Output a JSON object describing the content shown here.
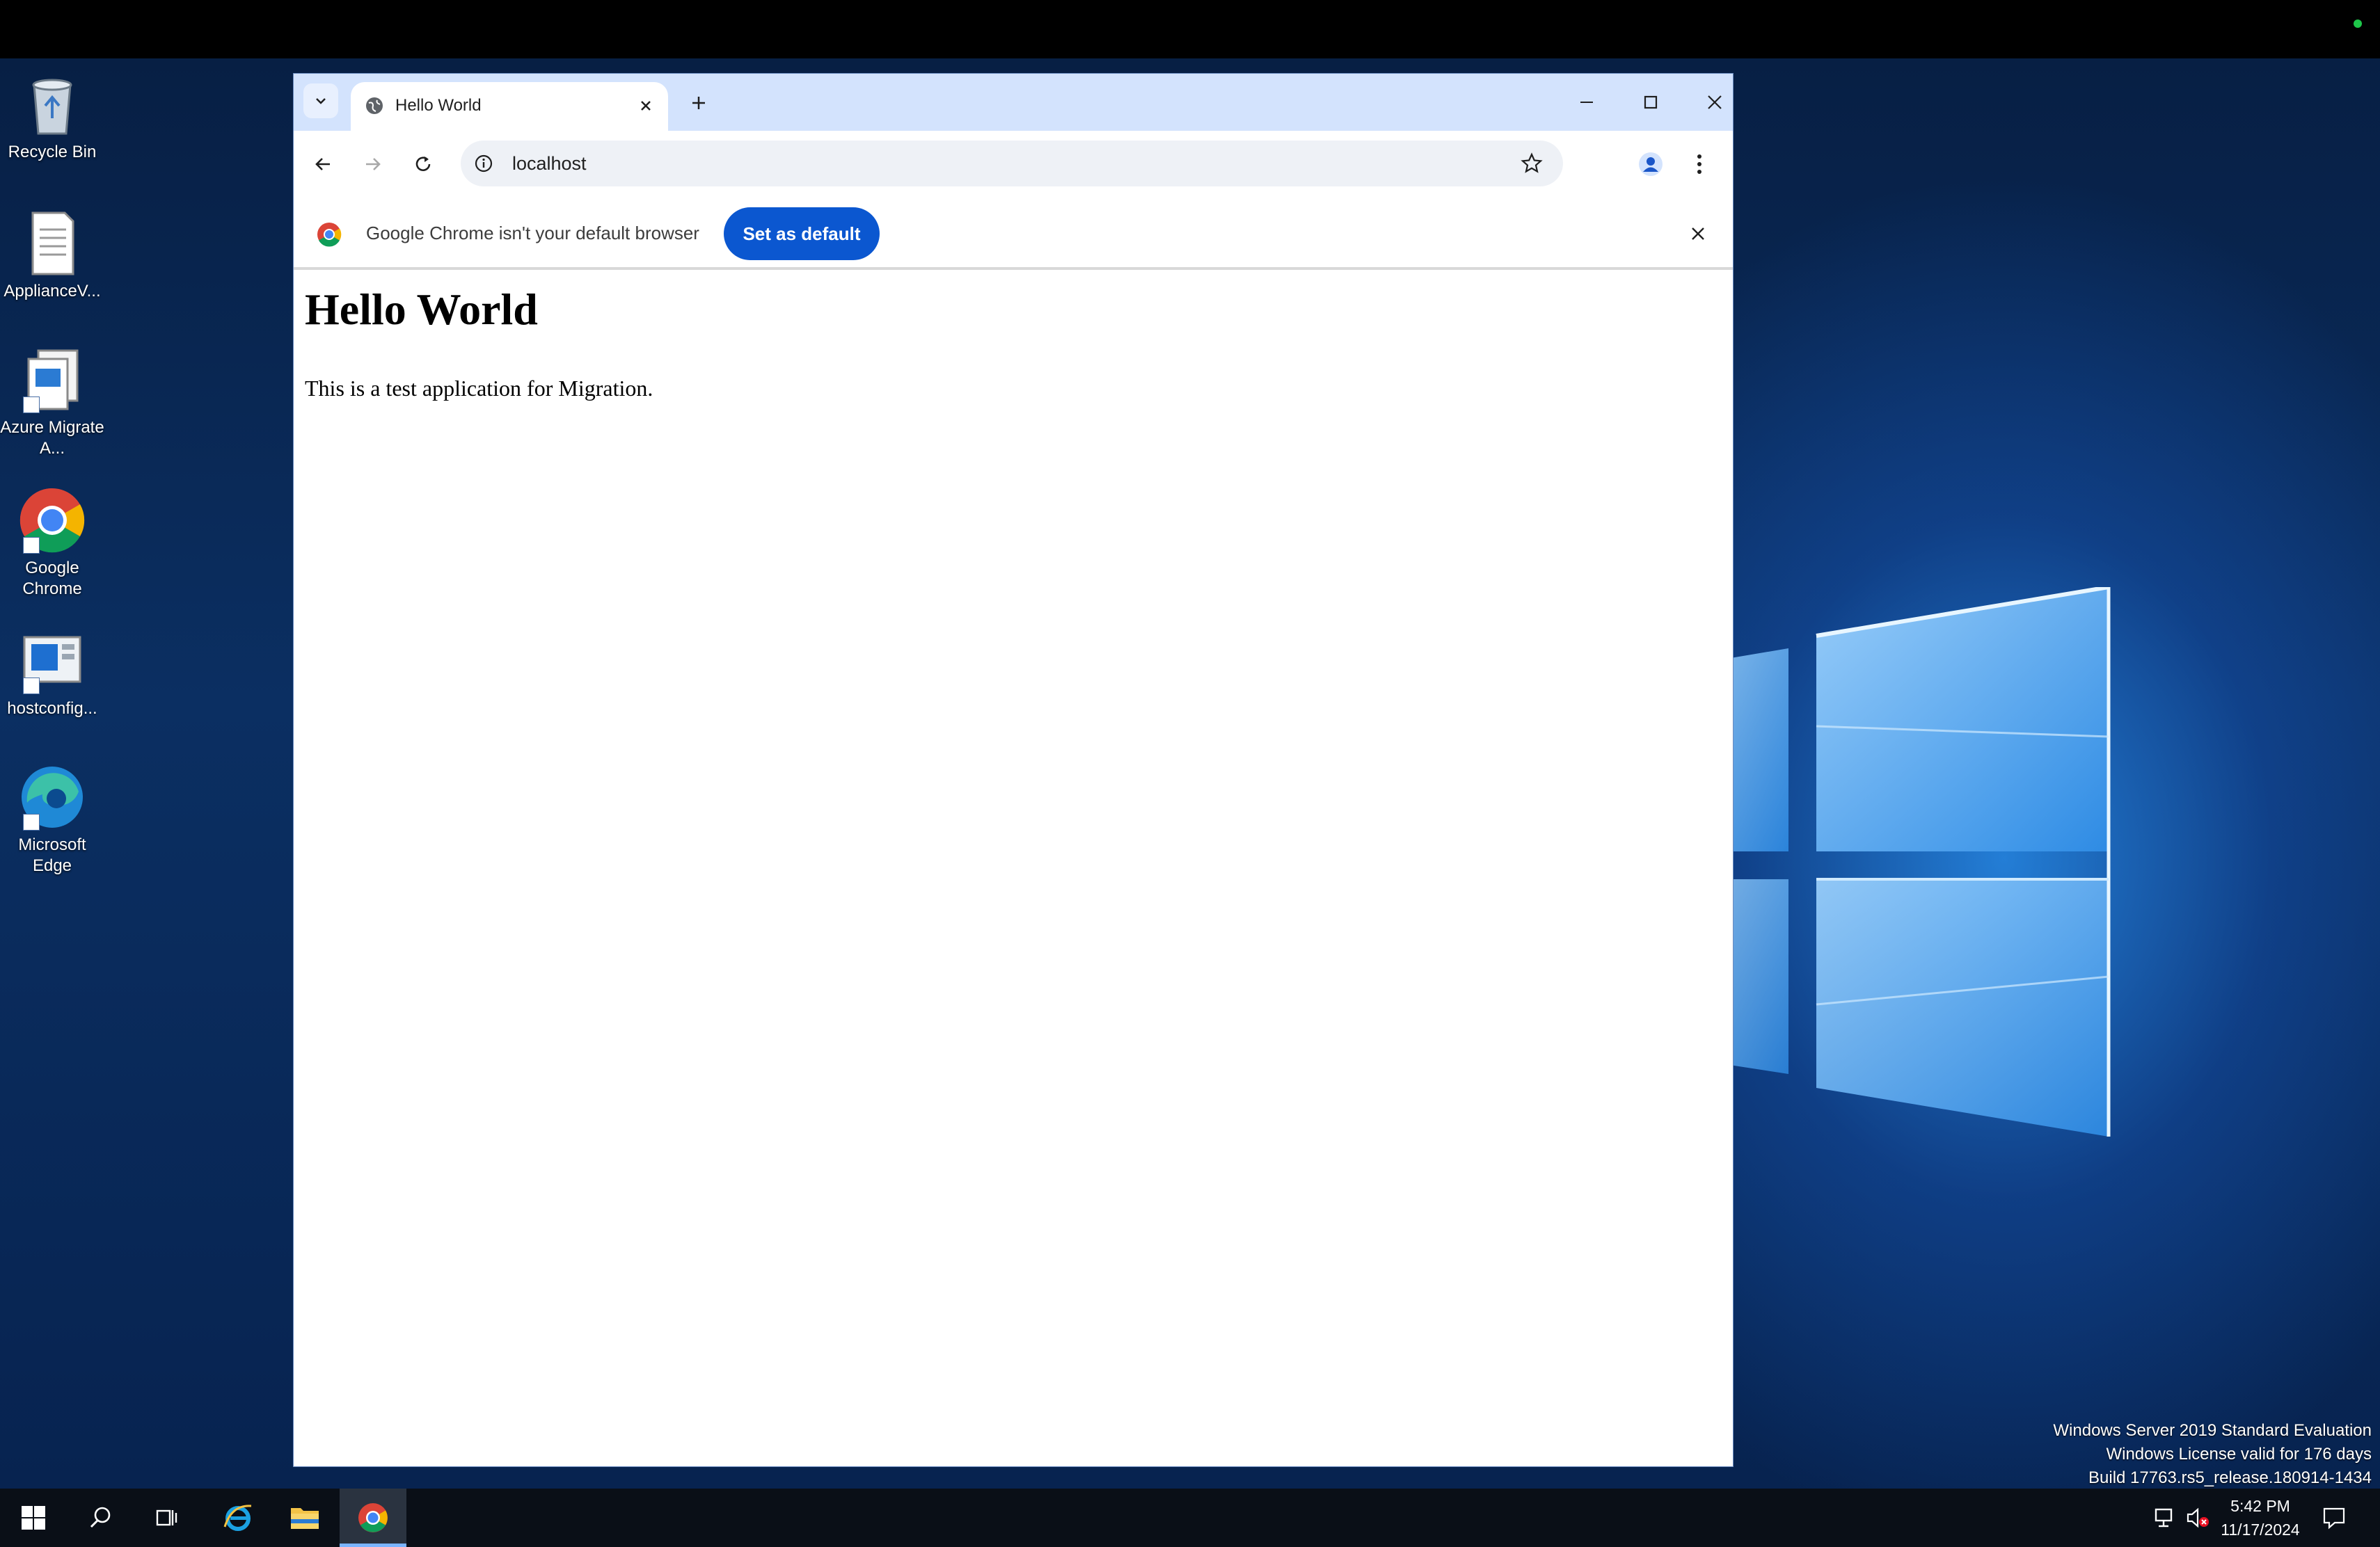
{
  "desktop": {
    "icons": [
      {
        "label": "Recycle Bin"
      },
      {
        "label": "ApplianceV..."
      },
      {
        "label": "Azure Migrate A..."
      },
      {
        "label": "Google Chrome"
      },
      {
        "label": "hostconfig..."
      },
      {
        "label": "Microsoft Edge"
      }
    ],
    "watermark": {
      "line1": "Windows Server 2019 Standard Evaluation",
      "line2": "Windows License valid for 176 days",
      "line3": "Build 17763.rs5_release.180914-1434"
    }
  },
  "browser": {
    "tab": {
      "title": "Hello World"
    },
    "omnibox": {
      "url": "localhost"
    },
    "infobar": {
      "message": "Google Chrome isn't your default browser",
      "button_label": "Set as default"
    },
    "page": {
      "heading": "Hello World",
      "paragraph": "This is a test application for Migration."
    }
  },
  "taskbar": {
    "time": "5:42 PM",
    "date": "11/17/2024"
  },
  "colors": {
    "accent": "#0b57d0",
    "tabbar": "#d3e3fd",
    "taskbar": "#0a0f17"
  }
}
